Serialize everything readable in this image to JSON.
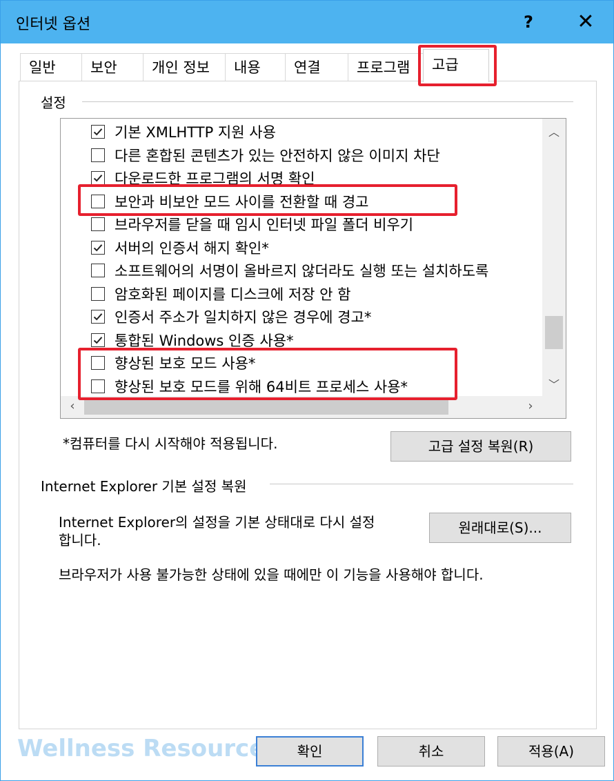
{
  "window": {
    "title": "인터넷 옵션",
    "help_label": "?",
    "close_label": "✕"
  },
  "tabs": [
    {
      "label": "일반",
      "active": false
    },
    {
      "label": "보안",
      "active": false
    },
    {
      "label": "개인 정보",
      "active": false
    },
    {
      "label": "내용",
      "active": false
    },
    {
      "label": "연결",
      "active": false
    },
    {
      "label": "프로그램",
      "active": false
    },
    {
      "label": "고급",
      "active": true
    }
  ],
  "settings": {
    "group_label": "설정",
    "items": [
      {
        "label": "기본 XMLHTTP 지원 사용",
        "checked": true
      },
      {
        "label": "다른 혼합된 콘텐츠가 있는 안전하지 않은 이미지 차단",
        "checked": false
      },
      {
        "label": "다운로드한 프로그램의 서명 확인",
        "checked": true
      },
      {
        "label": "보안과 비보안 모드 사이를 전환할 때 경고",
        "checked": false
      },
      {
        "label": "브라우저를 닫을 때 임시 인터넷 파일 폴더 비우기",
        "checked": false
      },
      {
        "label": "서버의 인증서 해지 확인*",
        "checked": true
      },
      {
        "label": "소프트웨어의 서명이 올바르지 않더라도 실행 또는 설치하도록",
        "checked": false
      },
      {
        "label": "암호화된 페이지를 디스크에 저장 안 함",
        "checked": false
      },
      {
        "label": "인증서 주소가 일치하지 않은 경우에 경고*",
        "checked": true
      },
      {
        "label": "통합된 Windows 인증 사용*",
        "checked": true
      },
      {
        "label": "향상된 보호 모드 사용*",
        "checked": false
      },
      {
        "label": "향상된 보호 모드를 위해 64비트 프로세스 사용*",
        "checked": false
      }
    ],
    "restart_note": "*컴퓨터를 다시 시작해야 적용됩니다.",
    "restore_advanced_label": "고급 설정 복원(R)"
  },
  "reset": {
    "group_label": "Internet Explorer 기본 설정 복원",
    "description_line1": "Internet Explorer의 설정을 기본 상태대로 다시 설정",
    "description_line2": "합니다.",
    "reset_button_label": "원래대로(S)...",
    "warning": "브라우저가 사용 불가능한 상태에 있을 때에만 이 기능을 사용해야 합니다."
  },
  "footer": {
    "ok_label": "확인",
    "cancel_label": "취소",
    "apply_label": "적용(A)",
    "watermark": "Wellness Resources"
  },
  "colors": {
    "titlebar": "#4db3f0",
    "highlight": "#e6202e"
  }
}
